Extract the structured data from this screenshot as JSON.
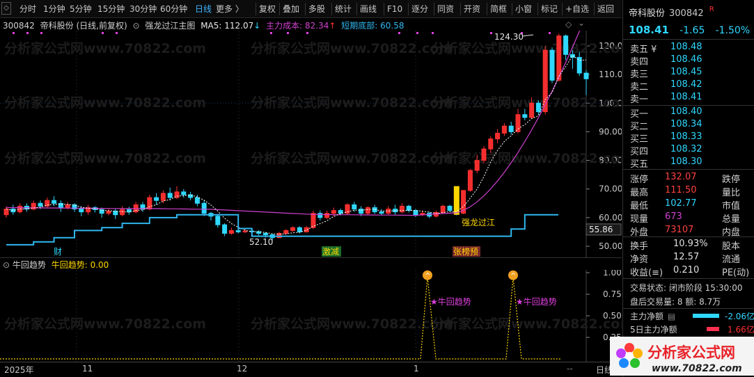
{
  "toolbar": {
    "items": [
      "分时",
      "1分钟",
      "5分钟",
      "15分钟",
      "30分钟",
      "60分钟",
      "日线",
      "更多 〉",
      "复权",
      "叠加",
      "多股",
      "统计",
      "画线",
      "F10",
      "逐分",
      "同资",
      "开资",
      "简框",
      "小窗",
      "标记",
      "+自选",
      "返回"
    ],
    "collapse_glyph": "◇"
  },
  "main_chart": {
    "code": "300842",
    "name": "帝科股份 (日线,前复权)",
    "indicator_name": "强龙过江主图",
    "ma5_label": "MA5: 112.07",
    "ma5_arrow": "↓",
    "cost_label": "主力成本: 82.34",
    "cost_arrow": "↑",
    "bottom_label": "短期底部: 60.58",
    "y_ticks": [
      "120.0",
      "110.0",
      "100.0",
      "90.00",
      "80.00",
      "70.00",
      "60.00",
      "50.00"
    ],
    "price_tag": "55.86",
    "high_label": "124.30",
    "low_label": "52.10",
    "event_labels": [
      "财",
      "激减",
      "张榜预"
    ],
    "signal_label": "强龙过江",
    "watermark": "分析家公式网www.70822.com",
    "corner_icons": [
      "◇",
      "⌄"
    ]
  },
  "sub_chart": {
    "name": "牛回趋势",
    "value_label": "牛回趋势: 0.00",
    "y_ticks": [
      "1.00",
      "0.75",
      "0.50",
      "0.25"
    ],
    "markers": [
      "★牛回趋势",
      "★牛回趋势"
    ]
  },
  "x_axis": {
    "labels": [
      "2025年",
      "11",
      "12",
      "1"
    ],
    "suffix": "--",
    "tab_label": "日线"
  },
  "quote": {
    "name": "帝科股份",
    "code": "300842",
    "flag": "R",
    "price": "108.41",
    "change": "-1.65",
    "change_pct": "-1.50%",
    "sell": [
      {
        "label": "卖五 ¥",
        "price": "108.48"
      },
      {
        "label": "卖四",
        "price": "108.46"
      },
      {
        "label": "卖三",
        "price": "108.45"
      },
      {
        "label": "卖二",
        "price": "108.42"
      },
      {
        "label": "卖一",
        "price": "108.41"
      }
    ],
    "buy": [
      {
        "label": "买一",
        "price": "108.40"
      },
      {
        "label": "买二",
        "price": "108.34"
      },
      {
        "label": "买三",
        "price": "108.33"
      },
      {
        "label": "买四",
        "price": "108.32"
      },
      {
        "label": "买五",
        "price": "108.30"
      }
    ],
    "stats": [
      {
        "label": "涨停",
        "value": "132.07",
        "color": "#ff4040",
        "label2": "跌停"
      },
      {
        "label": "最高",
        "value": "111.50",
        "color": "#ff4040",
        "label2": "量比"
      },
      {
        "label": "最低",
        "value": "102.77",
        "color": "#2fd8ff",
        "label2": "市值"
      },
      {
        "label": "现量",
        "value": "673",
        "color": "#d040d0",
        "label2": "总量"
      },
      {
        "label": "外盘",
        "value": "73107",
        "color": "#ff4040",
        "label2": "内盘"
      }
    ],
    "stats2": [
      {
        "label": "换手",
        "value": "10.93%",
        "label2": "股本"
      },
      {
        "label": "净资",
        "value": "12.57",
        "label2": "流通"
      },
      {
        "label": "收益(≡)",
        "value": "0.210",
        "label2": "PE(动)"
      }
    ],
    "trade_status": "交易状态: 闭市阶段 15:30:00",
    "after_hours": "盘后交易量: 8  额: 8.7万",
    "main_flow_label": "主力净额",
    "main_flow_value": "-2.06亿",
    "flow5_label": "5日主力净额",
    "flow5_value": "1.66亿"
  },
  "logo": {
    "text": "分析家公式网",
    "url_text": "www.70822.com"
  },
  "colors": {
    "up": "#ff3030",
    "down": "#2fd8ff",
    "ma": "#d040d0",
    "support": "#2fb8f0",
    "signal": "#ffd700"
  }
}
